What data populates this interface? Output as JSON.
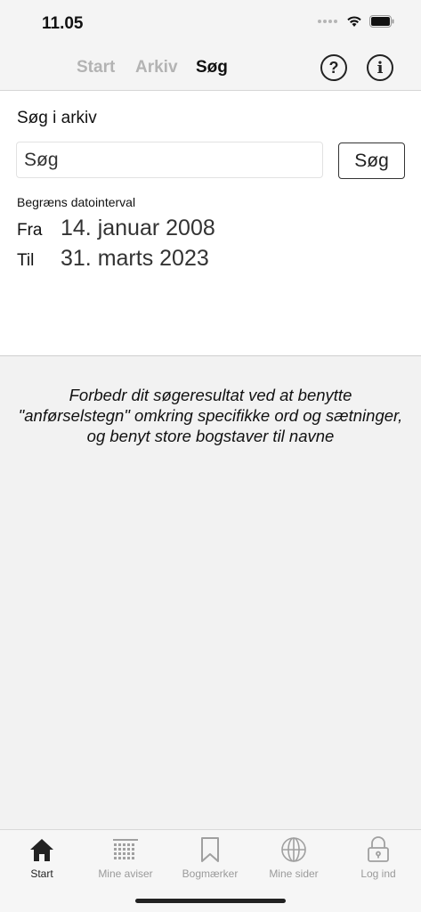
{
  "status": {
    "time": "11.05"
  },
  "nav": {
    "tabs": [
      "Start",
      "Arkiv",
      "Søg"
    ],
    "help_glyph": "?",
    "info_glyph": "i"
  },
  "search": {
    "title": "Søg i arkiv",
    "placeholder": "Søg",
    "button_label": "Søg",
    "range_label": "Begræns datointerval",
    "from_label": "Fra",
    "from_value": "14. januar 2008",
    "to_label": "Til",
    "to_value": "31. marts 2023"
  },
  "hint": {
    "line1": "Forbedr dit søgeresultat ved at benytte",
    "line2": "\"anførselstegn\" omkring specifikke ord og sætninger,",
    "line3": "og benyt store bogstaver til navne"
  },
  "tabbar": {
    "items": [
      {
        "label": "Start",
        "icon": "home-icon",
        "active": true
      },
      {
        "label": "Mine aviser",
        "icon": "newspaper-grid-icon",
        "active": false
      },
      {
        "label": "Bogmærker",
        "icon": "bookmark-icon",
        "active": false
      },
      {
        "label": "Mine sider",
        "icon": "globe-icon",
        "active": false
      },
      {
        "label": "Log ind",
        "icon": "lock-icon",
        "active": false
      }
    ]
  },
  "colors": {
    "active": "#222222",
    "inactive": "#9a9a9a",
    "panel": "#ffffff",
    "background": "#f2f2f2"
  }
}
